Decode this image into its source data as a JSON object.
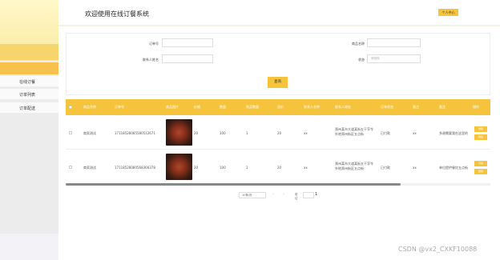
{
  "sidebar": {
    "logo_text": "",
    "user_text": "",
    "home_label": "",
    "group_label": "",
    "items": [
      {
        "label": "在线订餐"
      },
      {
        "label": "订单列表"
      },
      {
        "label": "订单配送"
      }
    ]
  },
  "header": {
    "title": "欢迎使用在线订餐系统",
    "profile_button": "个人中心"
  },
  "search": {
    "order_no_label": "订单号",
    "product_name_label": "商品名称",
    "contact_name_label": "联系人姓名",
    "status_label": "状态",
    "status_placeholder": "请选择",
    "search_button": "查询"
  },
  "table": {
    "headers": [
      "商品名称",
      "订单号",
      "商品图片",
      "价格",
      "数量",
      "购买数量",
      "总价",
      "联系人名称",
      "联系人地址",
      "订单状态",
      "备注",
      "备注",
      "操作"
    ],
    "rows": [
      {
        "product_name": "商家测试",
        "order_no": "17118528085580512671",
        "price": "20",
        "quantity": "100",
        "buy_count": "1",
        "total": "20",
        "contact_name": "xx",
        "contact_address": "郑州某市大道某街五干孚令外地郑州街区五点街",
        "order_status": "已付款",
        "remark1": "xx",
        "remark2": "多谢需要我在这里的",
        "action_primary": "详情",
        "action_secondary": "删除"
      },
      {
        "product_name": "商家测试",
        "order_no": "17118528080568366378",
        "price": "20",
        "quantity": "100",
        "buy_count": "1",
        "total": "20",
        "contact_name": "xx",
        "contact_address": "郑州某市大道某街五干孚令外地郑州街区五点街",
        "order_status": "已付款",
        "remark1": "xx",
        "remark2": "单位提供餐饮五点街",
        "action_primary": "详情",
        "action_secondary": "删除"
      }
    ]
  },
  "pagination": {
    "page_size": "10条/页",
    "prev": "‹",
    "next": "›",
    "goto_label": "前往",
    "current_page": "1"
  },
  "watermark": "CSDN @vx2_CXKF10088",
  "colors": {
    "accent": "#f6c43c",
    "sidebar_top": "#fff8c9",
    "header_border": "#f3f0e3"
  }
}
